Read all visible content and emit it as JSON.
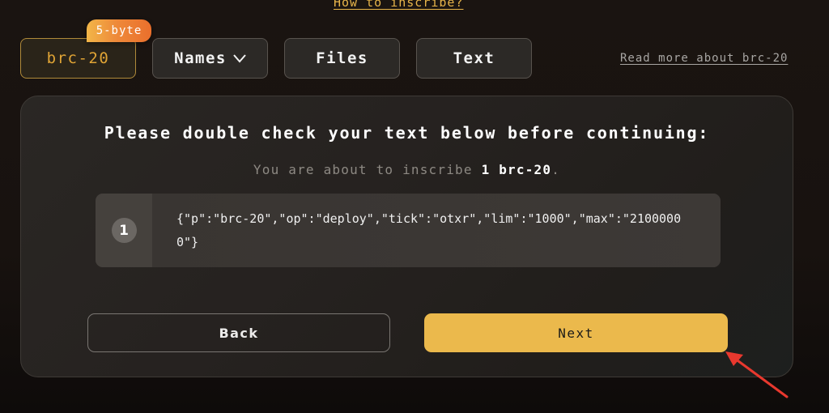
{
  "header": {
    "how_to_link": "How to inscribe?",
    "read_more_link": "Read more about brc-20"
  },
  "tabs": [
    {
      "label": "brc-20",
      "active": true,
      "badge": "5-byte"
    },
    {
      "label": "Names",
      "dropdown": true,
      "icon": "chevron-down-icon"
    },
    {
      "label": "Files"
    },
    {
      "label": "Text"
    }
  ],
  "card": {
    "title": "Please double check your text below before continuing:",
    "subtitle_prefix": "You are about to inscribe ",
    "subtitle_count": "1 brc-20",
    "subtitle_suffix": ".",
    "entries": [
      {
        "index": "1",
        "text": "{\"p\":\"brc-20\",\"op\":\"deploy\",\"tick\":\"otxr\",\"lim\":\"1000\",\"max\":\"21000000\"}"
      }
    ],
    "back_label": "Back",
    "next_label": "Next"
  },
  "colors": {
    "accent": "#ebb94c",
    "link": "#e8b54a",
    "badge_start": "#f2b648",
    "badge_end": "#ea6f2c",
    "annotation_arrow": "#e8382e"
  },
  "annotation": {
    "type": "arrow",
    "target": "next-button",
    "icon": "red-arrow-icon"
  }
}
